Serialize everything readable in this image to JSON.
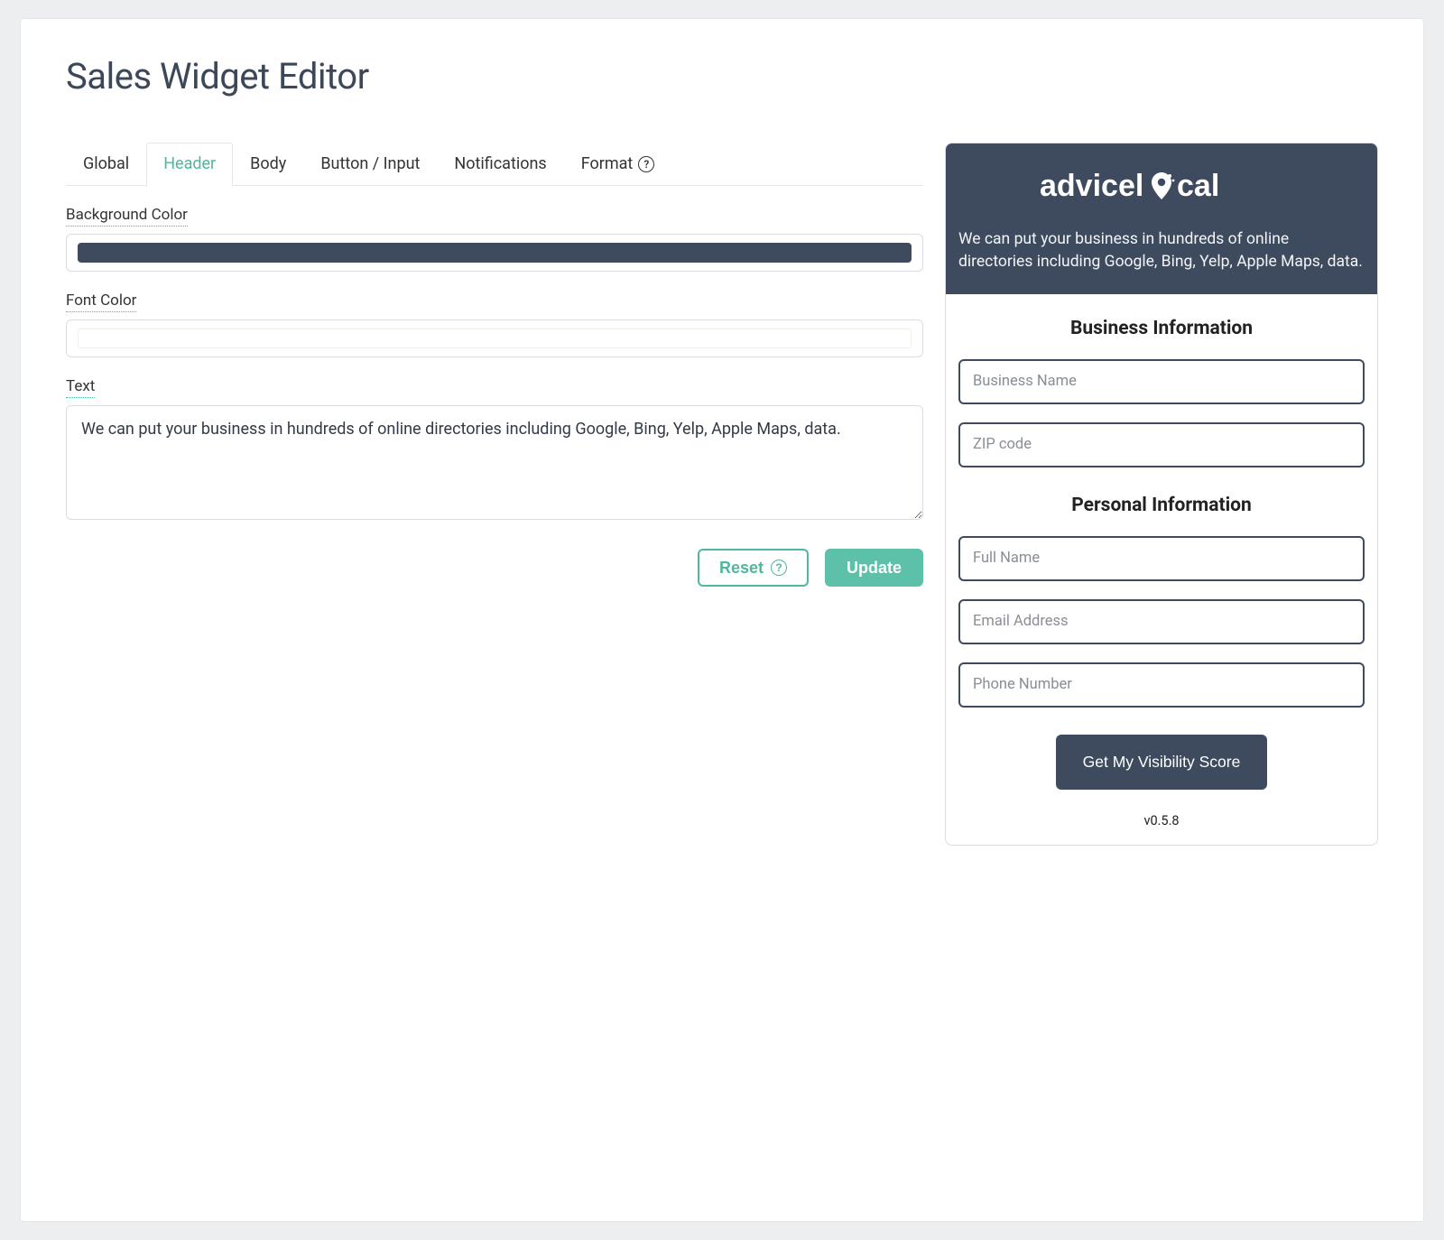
{
  "page_title": "Sales Widget Editor",
  "tabs": [
    {
      "label": "Global"
    },
    {
      "label": "Header"
    },
    {
      "label": "Body"
    },
    {
      "label": "Button / Input"
    },
    {
      "label": "Notifications"
    },
    {
      "label": "Format"
    }
  ],
  "active_tab_index": 1,
  "form": {
    "bg_color_label": "Background Color",
    "bg_color_value": "#3e4a5d",
    "font_color_label": "Font Color",
    "font_color_value": "#ffffff",
    "text_label": "Text",
    "text_value": "We can put your business in hundreds of online directories including Google, Bing, Yelp, Apple Maps, data."
  },
  "actions": {
    "reset_label": "Reset",
    "update_label": "Update"
  },
  "preview": {
    "brand_name": "advicelocal",
    "header_text": "We can put your business in hundreds of online directories including Google, Bing, Yelp, Apple Maps, data.",
    "business_section_title": "Business Information",
    "personal_section_title": "Personal Information",
    "fields": {
      "business_name_ph": "Business Name",
      "zip_ph": "ZIP code",
      "full_name_ph": "Full Name",
      "email_ph": "Email Address",
      "phone_ph": "Phone Number"
    },
    "cta_label": "Get My Visibility Score",
    "version": "v0.5.8"
  },
  "colors": {
    "header_bg": "#3e4a5d",
    "accent": "#5cc1a8"
  }
}
